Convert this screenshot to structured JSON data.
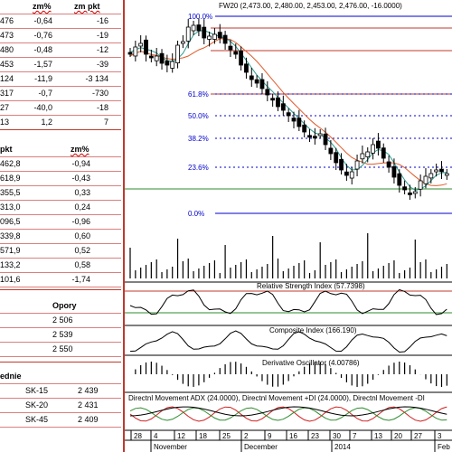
{
  "table1": {
    "headers": [
      "zm%",
      "zm pkt"
    ],
    "rows": [
      {
        "a": "476",
        "b": "-0,64",
        "c": "-16"
      },
      {
        "a": "473",
        "b": "-0,76",
        "c": "-19"
      },
      {
        "a": "480",
        "b": "-0,48",
        "c": "-12"
      },
      {
        "a": "453",
        "b": "-1,57",
        "c": "-39"
      },
      {
        "a": "124",
        "b": "-11,9",
        "c": "-3 134"
      },
      {
        "a": "317",
        "b": "-0,7",
        "c": "-730"
      },
      {
        "a": "27",
        "b": "-40,0",
        "c": "-18"
      },
      {
        "a": "13",
        "b": "1,2",
        "c": "7"
      }
    ]
  },
  "table2": {
    "headers": [
      "pkt",
      "zm%"
    ],
    "rows": [
      {
        "a": "462,8",
        "b": "-0,94"
      },
      {
        "a": "618,9",
        "b": "-0,43"
      },
      {
        "a": "355,5",
        "b": "0,33"
      },
      {
        "a": "313,0",
        "b": "0,24"
      },
      {
        "a": "096,5",
        "b": "-0,96"
      },
      {
        "a": "339,8",
        "b": "0,60"
      },
      {
        "a": "571,9",
        "b": "0,52"
      },
      {
        "a": "133,2",
        "b": "0,58"
      },
      {
        "a": "101,6",
        "b": "-1,74"
      }
    ]
  },
  "opory": {
    "header": "Opory",
    "values": [
      "2 506",
      "2 539",
      "2 550"
    ]
  },
  "srednie": {
    "header": "ednie",
    "rows": [
      {
        "label": "SK-15",
        "value": "2 439"
      },
      {
        "label": "SK-20",
        "value": "2 431"
      },
      {
        "label": "SK-45",
        "value": "2 409"
      }
    ]
  },
  "chart": {
    "title": "FW20 (2,473.00, 2,480.00, 2,453.00, 2,476.00, -16.0000)",
    "fib": [
      "100.0%",
      "61.8%",
      "50.0%",
      "38.2%",
      "23.6%",
      "0.0%"
    ],
    "panels": {
      "rsi": "Relative Strength Index (57.7398)",
      "composite": "Composite Index (166.190)",
      "derivative": "Derivative Oscillator (4.00786)",
      "dmi": "Directnl Movement ADX (24.0000), Directnl Movement +DI (24.0000), Directnl Movement -DI"
    },
    "dates": [
      "28",
      "4",
      "12",
      "18",
      "25",
      "2",
      "9",
      "16",
      "23",
      "30",
      "7",
      "13",
      "20",
      "27",
      "3"
    ],
    "months": [
      "November",
      "December",
      "2014",
      "Feb"
    ]
  },
  "colors": {
    "accent": "#c0392b",
    "fib_blue": "#0000cc",
    "ma_red": "#e05a2a",
    "ma_teal": "#2a9d8f",
    "support_green": "#2e8b2e"
  }
}
